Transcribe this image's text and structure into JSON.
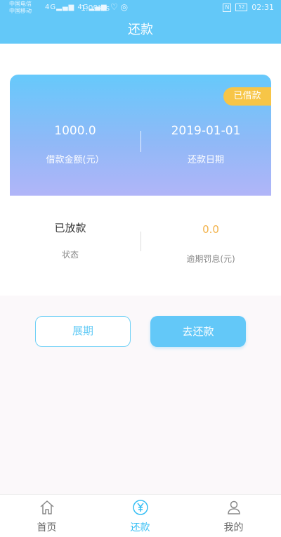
{
  "status_bar": {
    "carrier1": "中国电信",
    "carrier2": "中国移动",
    "net1": "4G",
    "net2": "4G",
    "speed": "1.09K/s",
    "nfc": "N",
    "battery": "52",
    "time": "02:31"
  },
  "header": {
    "title": "还款"
  },
  "loan_card": {
    "badge": "已借款",
    "amount": "1000.0",
    "amount_label": "借款金额(元）",
    "repay_date": "2019-01-01",
    "repay_date_label": "还款日期"
  },
  "info": {
    "status_value": "已放款",
    "status_label": "状态",
    "penalty_value": "0.0",
    "penalty_label": "逾期罚息(元)"
  },
  "actions": {
    "extend_label": "展期",
    "repay_label": "去还款"
  },
  "bottom_nav": {
    "items": [
      {
        "label": "首页",
        "icon": "home-icon",
        "active": false
      },
      {
        "label": "还款",
        "icon": "yen-icon",
        "active": true
      },
      {
        "label": "我的",
        "icon": "user-icon",
        "active": false
      }
    ]
  },
  "colors": {
    "primary": "#63c8f8",
    "badge": "#f7c547",
    "penalty": "#f2b24a"
  }
}
